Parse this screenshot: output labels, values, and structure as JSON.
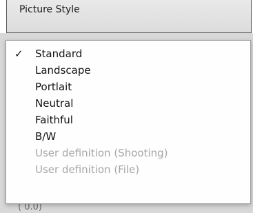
{
  "picture_style": {
    "title": "Picture Style"
  },
  "menu": {
    "check_mark": "✓",
    "items": [
      {
        "label": "Standard",
        "checked": true,
        "enabled": true
      },
      {
        "label": "Landscape",
        "checked": false,
        "enabled": true
      },
      {
        "label": "Portlait",
        "checked": false,
        "enabled": true
      },
      {
        "label": "Neutral",
        "checked": false,
        "enabled": true
      },
      {
        "label": "Faithful",
        "checked": false,
        "enabled": true
      },
      {
        "label": "B/W",
        "checked": false,
        "enabled": true
      },
      {
        "label": "User definition (Shooting)",
        "checked": false,
        "enabled": false
      },
      {
        "label": "User definition (File)",
        "checked": false,
        "enabled": false
      }
    ]
  },
  "below_menu_hint": "( 0.0)"
}
